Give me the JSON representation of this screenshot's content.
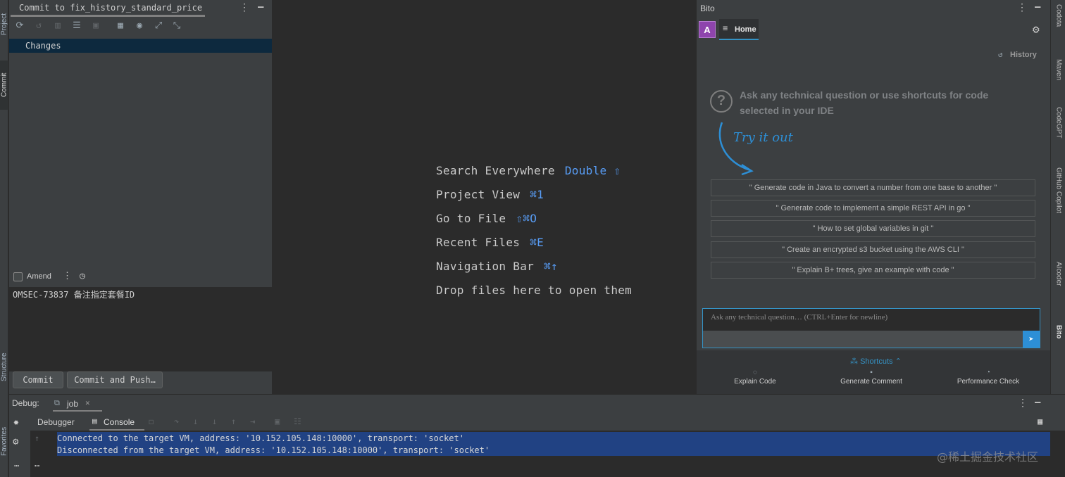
{
  "left_strip": {
    "project_tab": "Project",
    "commit_tab": "Commit",
    "structure_tab": "Structure",
    "favorites_tab": "Favorites"
  },
  "commit_panel": {
    "title": "Commit to fix_history_standard_price",
    "changes_label": "Changes",
    "amend_label": "Amend",
    "message": "OMSEC-73837 备注指定套餐ID",
    "commit_button": "Commit",
    "commit_push_button": "Commit and Push…"
  },
  "editor_hints": [
    {
      "label": "Search Everywhere",
      "shortcut": "Double ⇧"
    },
    {
      "label": "Project View",
      "shortcut": "⌘1"
    },
    {
      "label": "Go to File",
      "shortcut": "⇧⌘O"
    },
    {
      "label": "Recent Files",
      "shortcut": "⌘E"
    },
    {
      "label": "Navigation Bar",
      "shortcut": "⌘↑"
    },
    {
      "label": "Drop files here to open them",
      "shortcut": ""
    }
  ],
  "bito": {
    "title": "Bito",
    "avatar_letter": "A",
    "home_tab": "Home",
    "history_label": "History",
    "intro": "Ask any technical question or use shortcuts for code selected in your IDE",
    "try_it_out": "Try it out",
    "prompts": [
      "\" Generate code in Java to convert a number from one base to another \"",
      "\" Generate code to implement a simple REST API in go \"",
      "\" How to set global variables in git \"",
      "\" Create an encrypted s3 bucket using the AWS CLI \"",
      "\" Explain B+ trees, give an example with code \""
    ],
    "input_placeholder": "Ask any technical question… (CTRL+Enter for newline)",
    "shortcuts_label": "Shortcuts",
    "footer": [
      "Explain Code",
      "Generate Comment",
      "Performance Check"
    ],
    "accent": "#3592c4"
  },
  "right_strip": {
    "codota": "Codota",
    "maven": "Maven",
    "codegpt": "CodeGPT",
    "copilot": "GitHub Copilot",
    "aicoder": "AIcoder",
    "bito": "Bito"
  },
  "debug": {
    "label": "Debug:",
    "session_tab": "job",
    "debugger_tab": "Debugger",
    "console_tab": "Console",
    "console_lines": [
      "Connected to the target VM, address: '10.152.105.148:10000', transport: 'socket'",
      "Disconnected from the target VM, address: '10.152.105.148:10000', transport: 'socket'"
    ]
  },
  "watermark": "@稀土掘金技术社区"
}
